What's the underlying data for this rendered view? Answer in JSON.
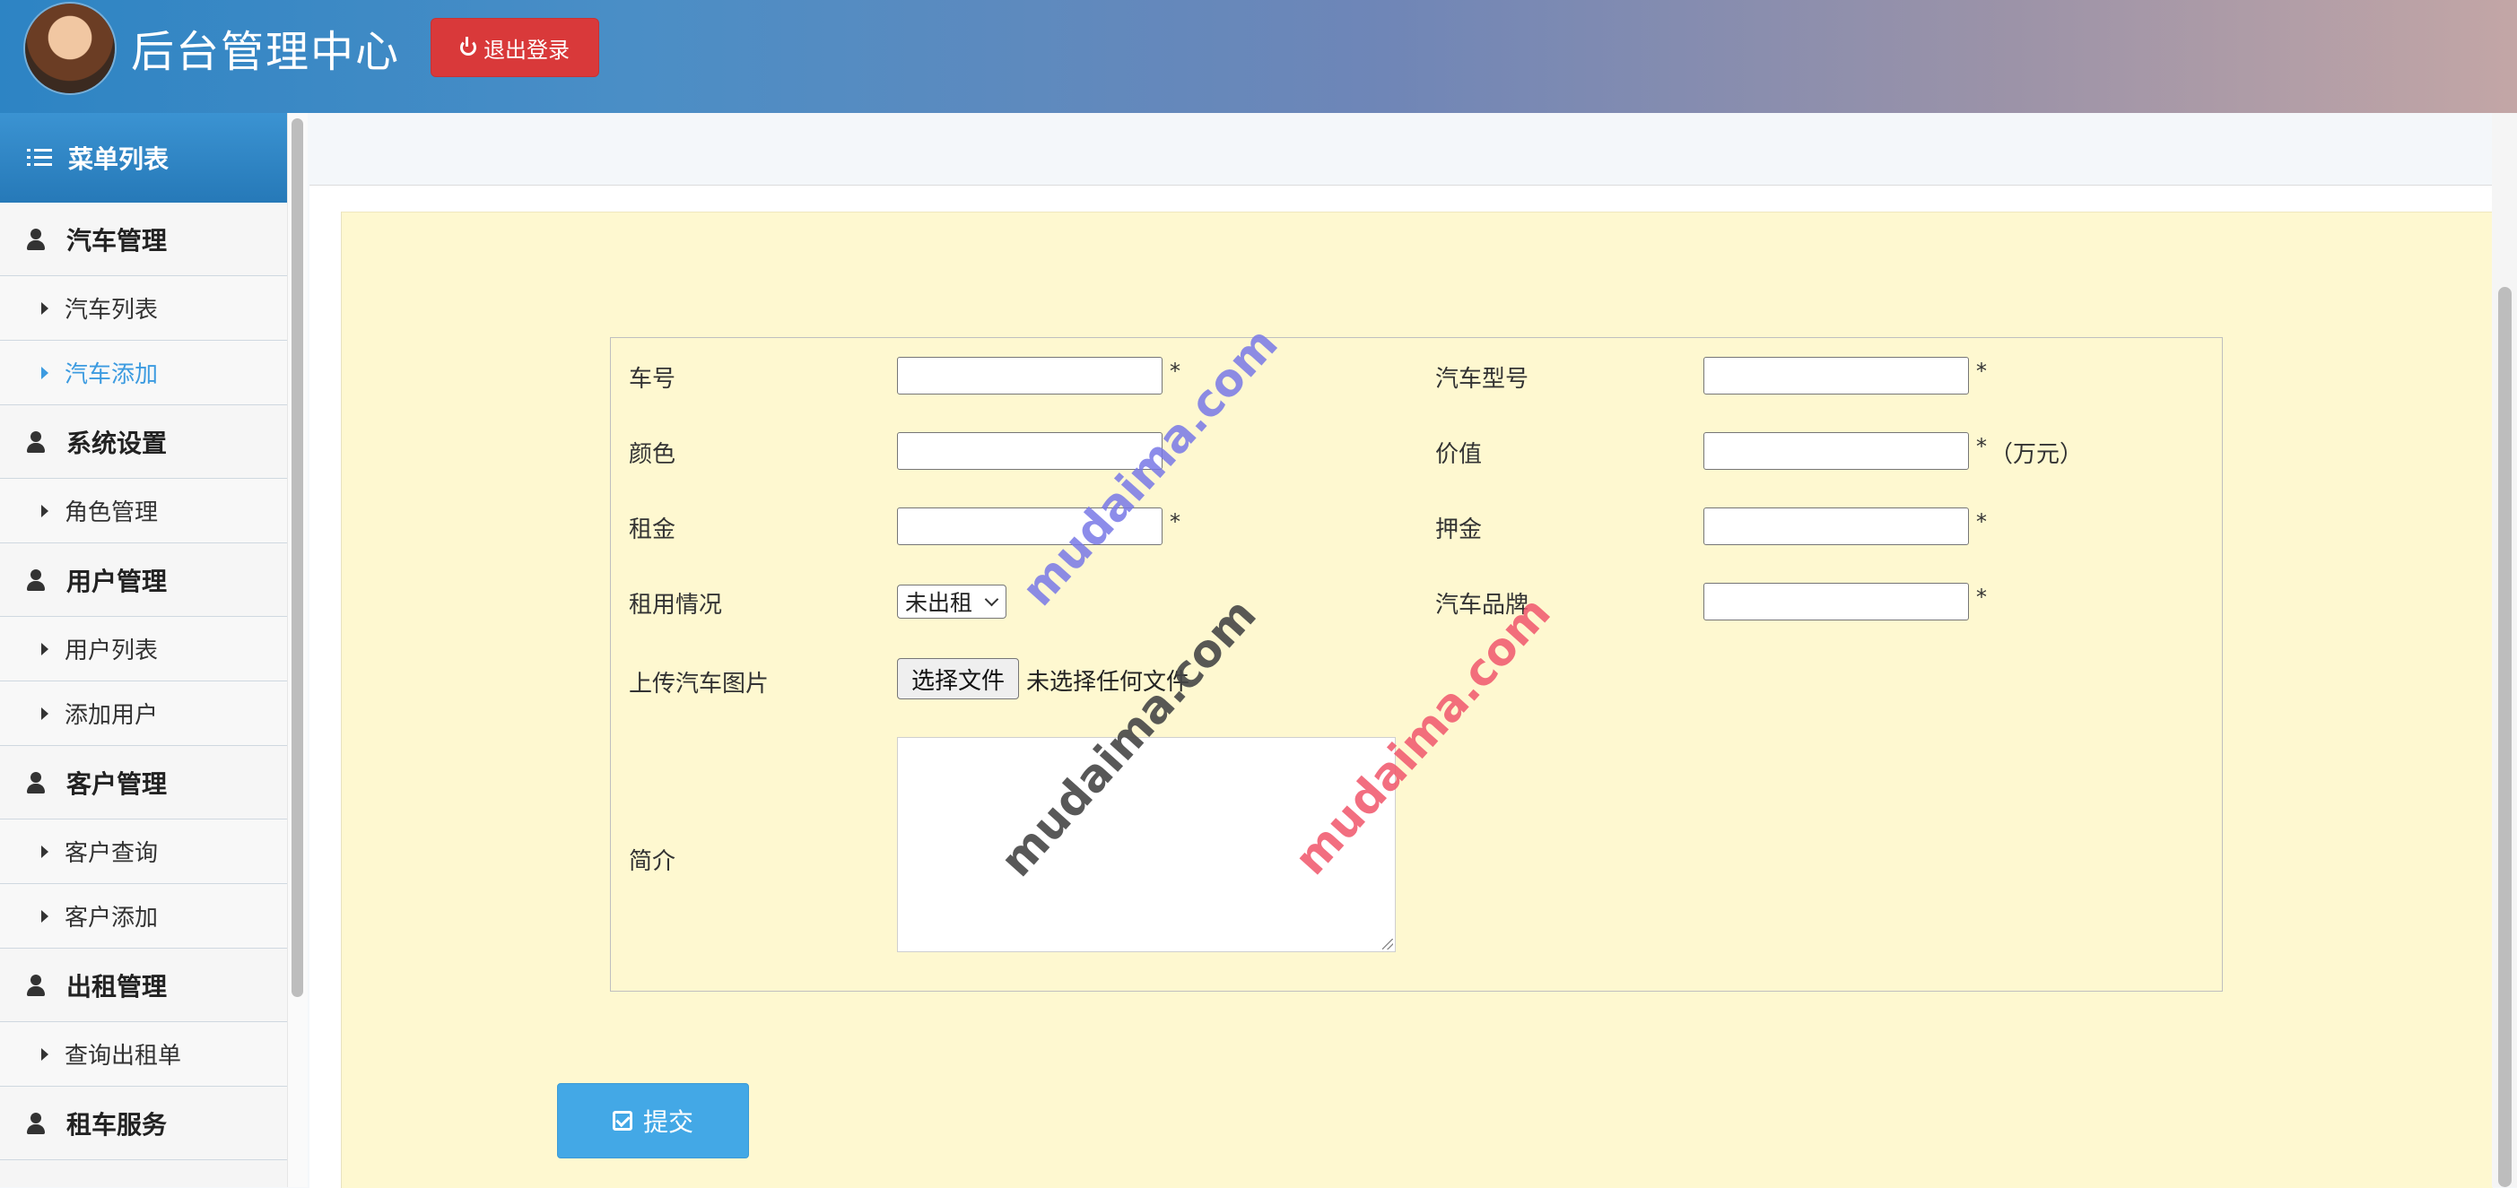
{
  "header": {
    "title": "后台管理中心",
    "logout_label": "退出登录"
  },
  "sidebar": {
    "title": "菜单列表",
    "groups": [
      {
        "label": "汽车管理",
        "items": [
          {
            "label": "汽车列表",
            "active": false
          },
          {
            "label": "汽车添加",
            "active": true
          }
        ]
      },
      {
        "label": "系统设置",
        "items": [
          {
            "label": "角色管理",
            "active": false
          }
        ]
      },
      {
        "label": "用户管理",
        "items": [
          {
            "label": "用户列表",
            "active": false
          },
          {
            "label": "添加用户",
            "active": false
          }
        ]
      },
      {
        "label": "客户管理",
        "items": [
          {
            "label": "客户查询",
            "active": false
          },
          {
            "label": "客户添加",
            "active": false
          }
        ]
      },
      {
        "label": "出租管理",
        "items": [
          {
            "label": "查询出租单",
            "active": false
          }
        ]
      },
      {
        "label": "租车服务",
        "items": []
      }
    ]
  },
  "form": {
    "car_no": {
      "label": "车号",
      "value": "",
      "required_mark": "*"
    },
    "model": {
      "label": "汽车型号",
      "value": "",
      "required_mark": "*"
    },
    "color": {
      "label": "颜色",
      "value": ""
    },
    "price": {
      "label": "价值",
      "value": "",
      "required_mark": "*",
      "unit": "（万元）"
    },
    "rent": {
      "label": "租金",
      "value": "",
      "required_mark": "*"
    },
    "deposit": {
      "label": "押金",
      "value": "",
      "required_mark": "*"
    },
    "status": {
      "label": "租用情况",
      "selected": "未出租"
    },
    "brand": {
      "label": "汽车品牌",
      "value": "",
      "required_mark": "*"
    },
    "image": {
      "label": "上传汽车图片",
      "button": "选择文件",
      "status_text": "未选择任何文件"
    },
    "intro": {
      "label": "简介",
      "value": ""
    },
    "submit_label": "提交"
  },
  "watermarks": [
    "mudaima.com",
    "mudaima.com",
    "mudaima.com"
  ],
  "colors": {
    "header_start": "#2d84c4",
    "logout_button": "#d9393a",
    "menu_active": "#3c9be0",
    "form_background": "#fef8d0",
    "submit_button": "#43a8e6"
  }
}
